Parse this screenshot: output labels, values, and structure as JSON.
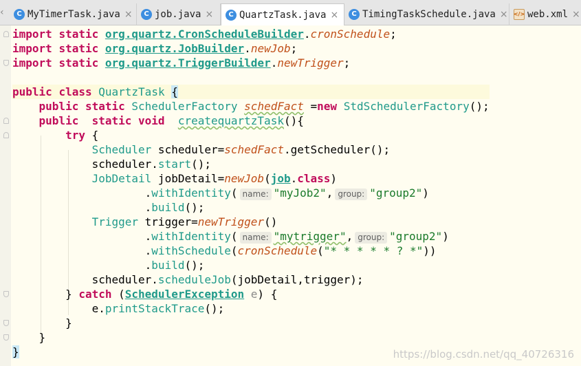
{
  "tabs": [
    {
      "label": "MyTimerTask.java",
      "icon": "class-icon",
      "active": false
    },
    {
      "label": "job.java",
      "icon": "class-icon",
      "active": false
    },
    {
      "label": "QuartzTask.java",
      "icon": "class-icon",
      "active": true
    },
    {
      "label": "TimingTaskSchedule.java",
      "icon": "class-icon",
      "active": false
    },
    {
      "label": "web.xml",
      "icon": "xml-file-icon",
      "active": false
    }
  ],
  "tab_close_glyph": "×",
  "code": {
    "l1": {
      "kw1": "import",
      "kw2": "static",
      "pkg": "org.quartz.CronScheduleBuilder",
      "dot": ".",
      "fn": "cronSchedule",
      "end": ";"
    },
    "l2": {
      "kw1": "import",
      "kw2": "static",
      "pkg": "org.quartz.JobBuilder",
      "dot": ".",
      "fn": "newJob",
      "end": ";"
    },
    "l3": {
      "kw1": "import",
      "kw2": "static",
      "pkg": "org.quartz.TriggerBuilder",
      "dot": ".",
      "fn": "newTrigger",
      "end": ";"
    },
    "l5": {
      "kw1": "public",
      "kw2": "class",
      "cls": "QuartzTask",
      "brace": "{"
    },
    "l6": {
      "kw1": "public",
      "kw2": "static",
      "type": "SchedulerFactory",
      "fld": "schedFact",
      "eq": " =",
      "kw3": "new",
      "ctor": "StdSchedulerFactory",
      "end": "();"
    },
    "l7": {
      "kw1": "public",
      "kw2": "static",
      "kw3": "void",
      "mth": "createquartzTask",
      "end": "(){"
    },
    "l8": {
      "kw": "try",
      "end": " {"
    },
    "l9": {
      "type": "Scheduler",
      "var": " scheduler=",
      "fld": "schedFact",
      "call": ".getScheduler();"
    },
    "l10": {
      "text": "scheduler.",
      "mth": "start",
      "end": "();"
    },
    "l11": {
      "type": "JobDetail",
      "var": " jobDetail=",
      "fn": "newJob",
      "p1": "(",
      "cls": "job",
      "dot": ".",
      "kw": "class",
      "p2": ")"
    },
    "l12": {
      "dot": ".",
      "mth": "withIdentity",
      "open": "(",
      "hint1": "name:",
      "s1": "\"myJob2\"",
      "comma": ",",
      "hint2": "group:",
      "s2": "\"group2\"",
      "close": ")"
    },
    "l13": {
      "dot": ".",
      "mth": "build",
      "end": "();"
    },
    "l14": {
      "type": "Trigger",
      "var": " trigger=",
      "fn": "newTrigger",
      "end": "()"
    },
    "l15": {
      "dot": ".",
      "mth": "withIdentity",
      "open": "(",
      "hint1": "name:",
      "s1": "\"mytrigger\"",
      "comma": ",",
      "hint2": "group:",
      "s2": "\"group2\"",
      "close": ")"
    },
    "l16": {
      "dot": ".",
      "mth": "withSchedule",
      "open": "(",
      "fn": "cronSchedule",
      "p": "(",
      "s": "\"* * * * * ? *\"",
      "close": "))"
    },
    "l17": {
      "dot": ".",
      "mth": "build",
      "end": "();"
    },
    "l18": {
      "text": "scheduler.",
      "mth": "scheduleJob",
      "end": "(jobDetail,trigger);"
    },
    "l19": {
      "brace": "} ",
      "kw": "catch",
      "p": " (",
      "cls": "SchedulerException",
      "var": " e",
      "end": ") {"
    },
    "l20": {
      "text": "e.",
      "mth": "printStackTrace",
      "end": "();"
    },
    "l21": {
      "text": "}"
    },
    "l22": {
      "text": "}"
    },
    "l23": {
      "brace": "}"
    }
  },
  "watermark": "https://blog.csdn.net/qq_40726316"
}
